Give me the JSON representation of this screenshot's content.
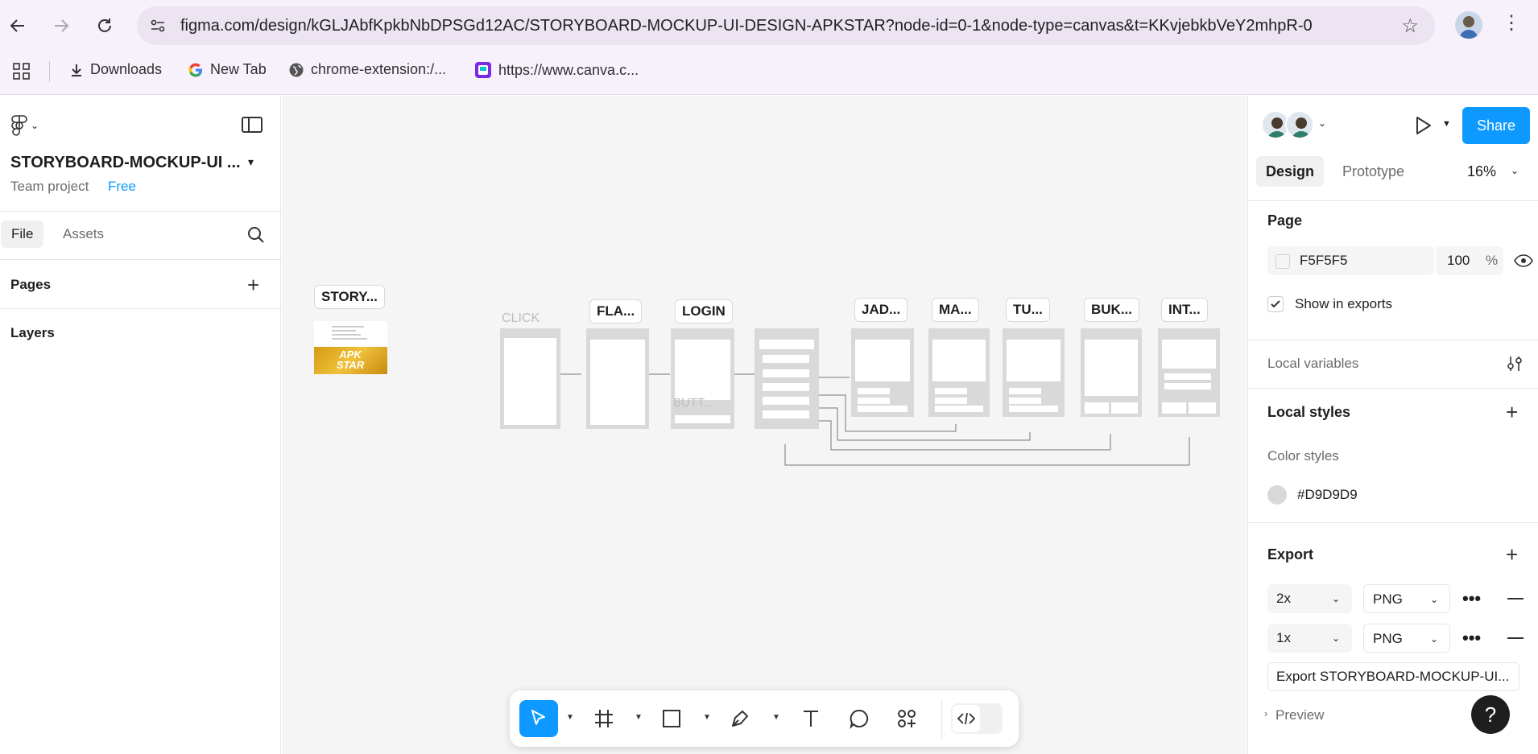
{
  "browser": {
    "url": "figma.com/design/kGLJAbfKpkbNbDPSGd12AC/STORYBOARD-MOCKUP-UI-DESIGN-APKSTAR?node-id=0-1&node-type=canvas&t=KKvjebkbVeY2mhpR-0",
    "bookmarks": [
      {
        "label": "Downloads",
        "icon": "download-icon"
      },
      {
        "label": "New Tab",
        "icon": "google-icon"
      },
      {
        "label": "chrome-extension:/...",
        "icon": "globe-icon"
      },
      {
        "label": "https://www.canva.c...",
        "icon": "canva-icon"
      }
    ]
  },
  "left_panel": {
    "file_name": "STORYBOARD-MOCKUP-UI ...",
    "team": "Team project",
    "plan": "Free",
    "tabs": [
      "File",
      "Assets"
    ],
    "pages_title": "Pages",
    "layers_title": "Layers"
  },
  "canvas": {
    "frames": [
      {
        "label": "STORY..."
      },
      {
        "label": "FLA..."
      },
      {
        "label": "LOGIN"
      },
      {
        "label": "JAD..."
      },
      {
        "label": "MA..."
      },
      {
        "label": "TU..."
      },
      {
        "label": "BUK..."
      },
      {
        "label": "INT..."
      }
    ],
    "ghost_texts": {
      "click": "CLICK",
      "butt": "BUTT...",
      "logo_text": "APK STAR"
    }
  },
  "toolbar": {
    "tools": [
      "move-tool",
      "frame-tool",
      "shape-tool",
      "pen-tool",
      "text-tool",
      "comment-tool",
      "actions-tool",
      "dev-mode-toggle"
    ]
  },
  "right_panel": {
    "share_label": "Share",
    "tabs": [
      "Design",
      "Prototype"
    ],
    "zoom": "16%",
    "page": {
      "title": "Page",
      "color": "F5F5F5",
      "opacity": "100",
      "percent": "%",
      "show_in_exports": "Show in exports"
    },
    "local_variables": "Local variables",
    "local_styles": "Local styles",
    "color_styles": "Color styles",
    "style_color": "#D9D9D9",
    "export": {
      "title": "Export",
      "rows": [
        {
          "scale": "2x",
          "format": "PNG"
        },
        {
          "scale": "1x",
          "format": "PNG"
        }
      ],
      "button": "Export STORYBOARD-MOCKUP-UI...",
      "preview": "Preview"
    }
  },
  "help_label": "?"
}
